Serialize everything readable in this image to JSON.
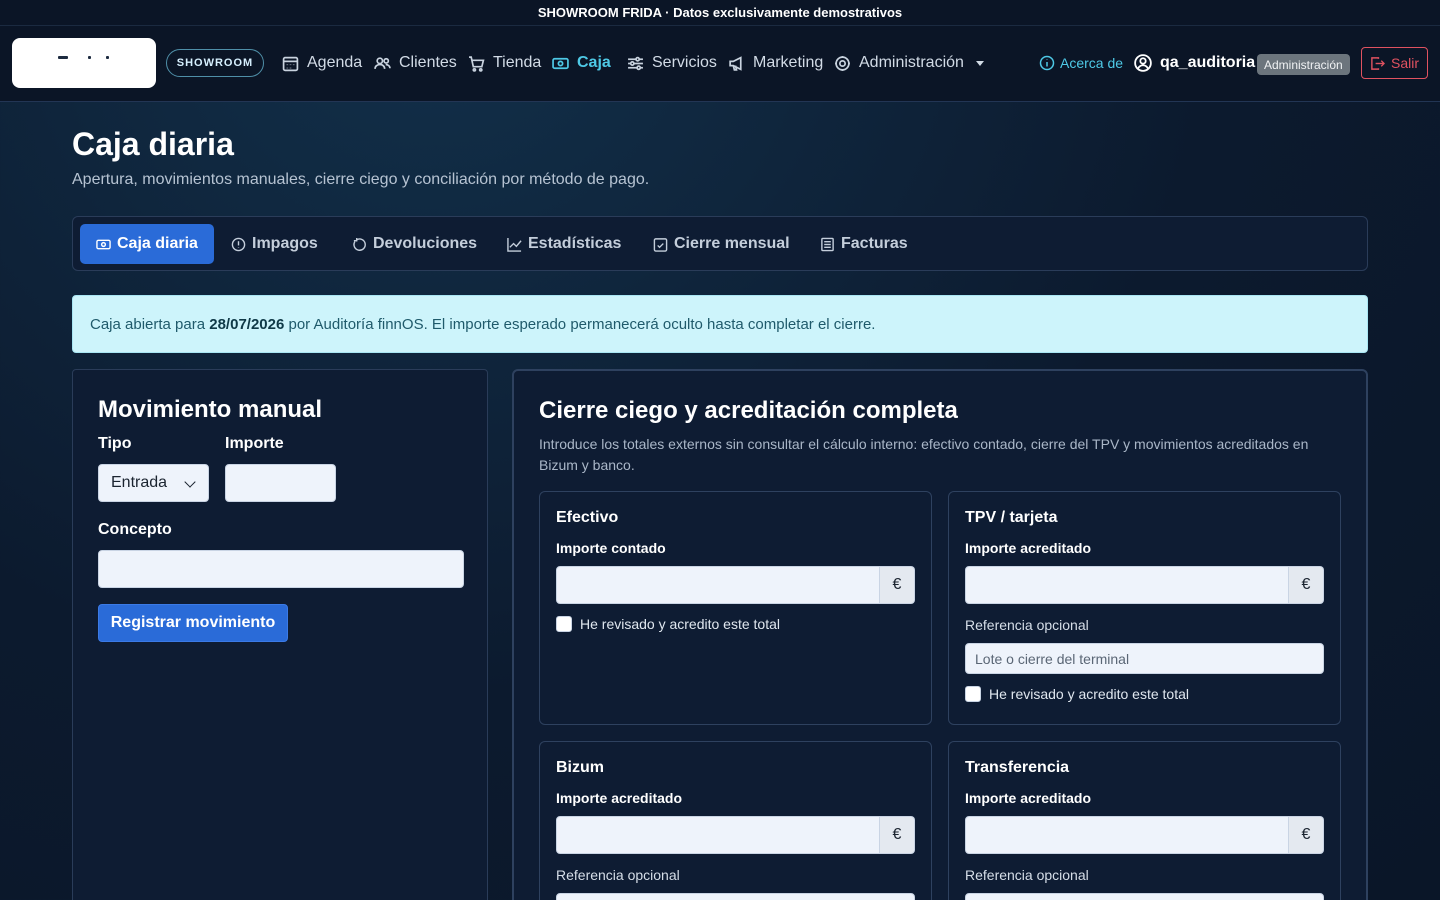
{
  "banner": {
    "text": "SHOWROOM FRIDA · Datos exclusivamente demostrativos"
  },
  "nav": {
    "showroom_badge": "SHOWROOM",
    "items": [
      {
        "label": "Agenda",
        "icon": "calendar-icon"
      },
      {
        "label": "Clientes",
        "icon": "users-icon"
      },
      {
        "label": "Tienda",
        "icon": "cart-icon"
      },
      {
        "label": "Caja",
        "icon": "cash-icon"
      },
      {
        "label": "Servicios",
        "icon": "sliders-icon"
      },
      {
        "label": "Marketing",
        "icon": "megaphone-icon"
      },
      {
        "label": "Administración",
        "icon": "gear-icon"
      }
    ],
    "active": "Caja",
    "about": "Acerca de",
    "user": "qa_auditoria",
    "role": "Administración",
    "logout": "Salir"
  },
  "page": {
    "title": "Caja diaria",
    "subtitle": "Apertura, movimientos manuales, cierre ciego y conciliación por método de pago."
  },
  "tabs": [
    {
      "label": "Caja diaria",
      "icon": "cash-icon"
    },
    {
      "label": "Impagos",
      "icon": "alert-circle-icon"
    },
    {
      "label": "Devoluciones",
      "icon": "refresh-icon"
    },
    {
      "label": "Estadísticas",
      "icon": "chart-line-icon"
    },
    {
      "label": "Cierre mensual",
      "icon": "calendar-check-icon"
    },
    {
      "label": "Facturas",
      "icon": "document-icon"
    }
  ],
  "alert": {
    "prefix": "Caja abierta para ",
    "date": "28/07/2026",
    "suffix": " por Auditoría finnOS. El importe esperado permanecerá oculto hasta completar el cierre."
  },
  "manual": {
    "title": "Movimiento manual",
    "tipo_label": "Tipo",
    "tipo_value": "Entrada",
    "importe_label": "Importe",
    "concepto_label": "Concepto",
    "submit": "Registrar movimiento"
  },
  "closing": {
    "title": "Cierre ciego y acreditación completa",
    "description": "Introduce los totales externos sin consultar el cálculo interno: efectivo contado, cierre del TPV y movimientos acreditados en Bizum y banco.",
    "currency": "€",
    "check_label": "He revisado y acredito este total",
    "ref_label": "Referencia opcional",
    "cards": {
      "efectivo": {
        "title": "Efectivo",
        "amount_label": "Importe contado"
      },
      "tpv": {
        "title": "TPV / tarjeta",
        "amount_label": "Importe acreditado",
        "ref_placeholder": "Lote o cierre del terminal"
      },
      "bizum": {
        "title": "Bizum",
        "amount_label": "Importe acreditado"
      },
      "transferencia": {
        "title": "Transferencia",
        "amount_label": "Importe acreditado"
      }
    }
  },
  "colors": {
    "accent": "#2a6bd8",
    "nav_active": "#4ec9e6",
    "danger": "#e05260",
    "alert_bg": "#cdf4fb"
  }
}
